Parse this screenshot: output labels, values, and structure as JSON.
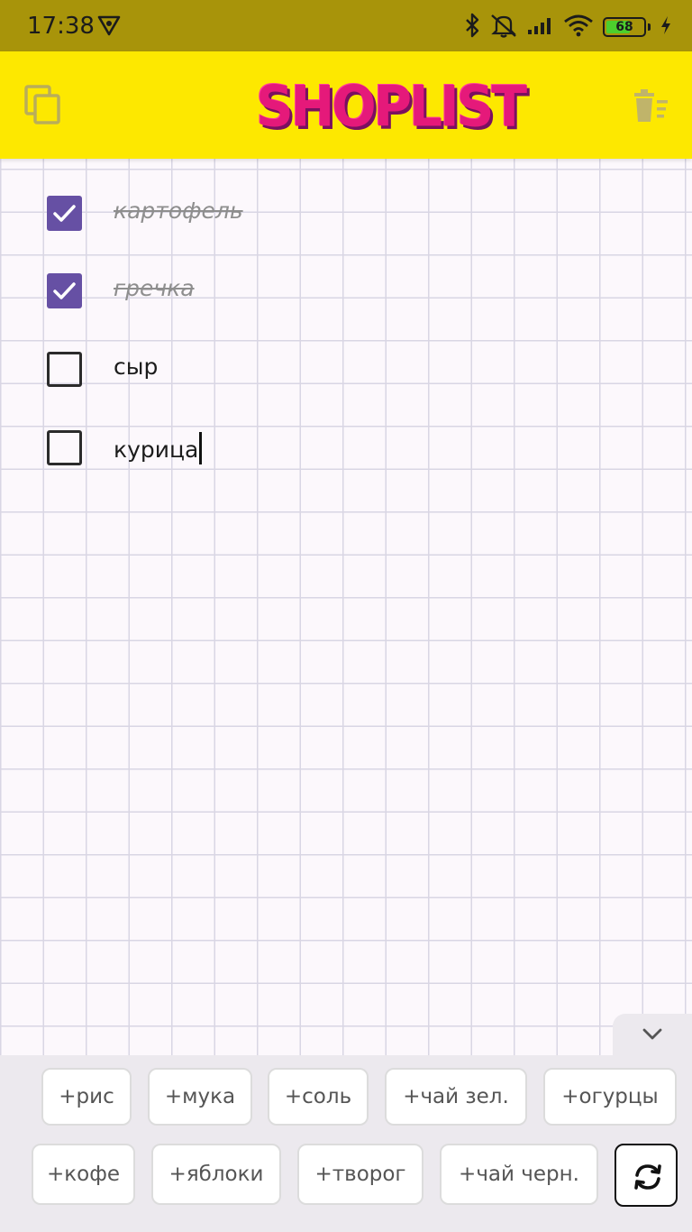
{
  "status_bar": {
    "time": "17:38",
    "battery_level": "68",
    "battery_fraction": 0.68,
    "icons": [
      "vpn-shield-icon",
      "bluetooth-icon",
      "silent-icon",
      "signal-icon",
      "wifi-icon",
      "battery-icon",
      "charging-icon"
    ]
  },
  "app_bar": {
    "title": "SHOPLIST",
    "left_icon": "copy-icon",
    "right_icon": "clear-list-icon"
  },
  "items": [
    {
      "label": "картофель",
      "checked": true
    },
    {
      "label": "гречка",
      "checked": true
    },
    {
      "label": "сыр",
      "checked": false
    },
    {
      "label": "курица",
      "checked": false
    }
  ],
  "suggestions": {
    "row1": [
      "+рис",
      "+мука",
      "+соль",
      "+чай зел.",
      "+огурцы"
    ],
    "row2": [
      "+кофе",
      "+яблоки",
      "+творог",
      "+чай черн."
    ],
    "refresh_icon": "refresh-icon",
    "collapse_icon": "chevron-down-icon"
  },
  "colors": {
    "status_bar": "#a8940a",
    "app_bar": "#fde800",
    "checkbox_checked": "#6650a4",
    "logo": "#e5197a"
  }
}
